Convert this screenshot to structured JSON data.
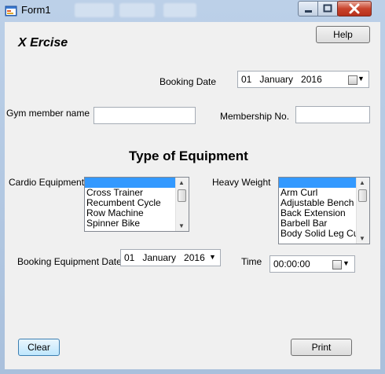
{
  "window": {
    "title": "Form1"
  },
  "brand": "X Ercise",
  "help_label": "Help",
  "booking": {
    "label": "Booking Date",
    "value": "01   January   2016"
  },
  "member": {
    "name_label": "Gym member name",
    "name_value": "",
    "no_label": "Membership No.",
    "no_value": ""
  },
  "equipment": {
    "heading": "Type of Equipment",
    "cardio_label": "Cardio Equipment",
    "cardio_items": [
      "",
      "Cross Trainer",
      "Recumbent Cycle",
      "Row Machine",
      "Spinner Bike"
    ],
    "heavy_label": "Heavy Weight",
    "heavy_items": [
      "",
      "Arm Curl",
      "Adjustable Bench",
      "Back Extension",
      "Barbell Bar",
      "Body Solid Leg Cu"
    ]
  },
  "equip_date": {
    "label": "Booking Equipment Date",
    "value": "01   January   2016"
  },
  "time": {
    "label": "Time",
    "value": "00:00:00"
  },
  "clear_label": "Clear",
  "print_label": "Print",
  "colors": {
    "selection": "#3399ff",
    "close_button": "#c8442d"
  }
}
